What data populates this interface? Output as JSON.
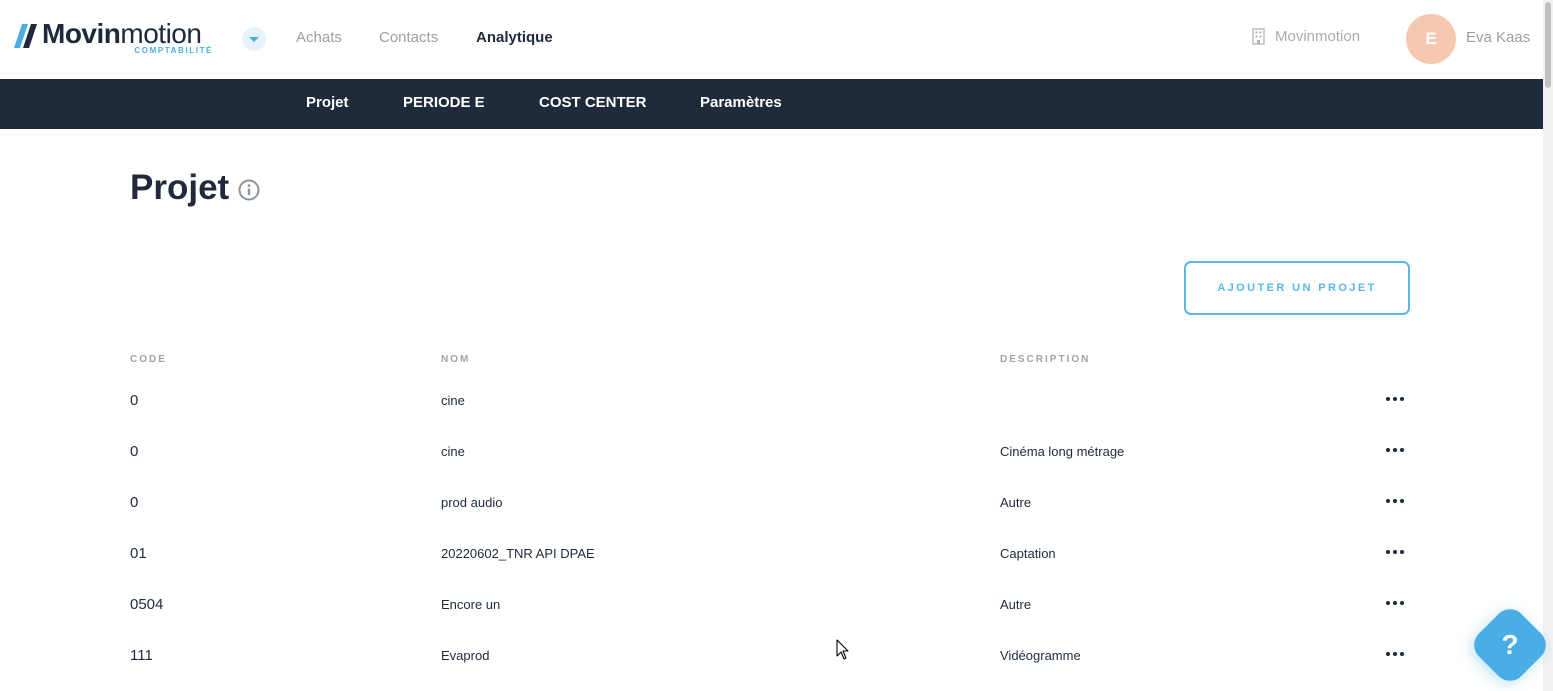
{
  "brand": {
    "name_bold": "Movin",
    "name_light": "motion",
    "subtitle": "COMPTABILITÉ",
    "accent_color": "#4aaee6",
    "dark_color": "#1f2a3b"
  },
  "app_switcher_icon": "chevron-down-icon",
  "top_nav": [
    {
      "label": "Achats",
      "active": false
    },
    {
      "label": "Contacts",
      "active": false
    },
    {
      "label": "Analytique",
      "active": true
    }
  ],
  "company": {
    "icon": "building-icon",
    "label": "Movinmotion"
  },
  "user": {
    "initial": "E",
    "name": "Eva Kaas"
  },
  "sub_nav": [
    {
      "label": "Projet"
    },
    {
      "label": "PERIODE E"
    },
    {
      "label": "COST CENTER"
    },
    {
      "label": "Paramètres"
    }
  ],
  "page": {
    "title": "Projet",
    "info_icon": "info-icon",
    "add_button_label": "AJOUTER UN PROJET"
  },
  "table": {
    "headers": {
      "code": "CODE",
      "nom": "NOM",
      "description": "DESCRIPTION"
    },
    "rows": [
      {
        "code": "0",
        "nom": "cine",
        "description": ""
      },
      {
        "code": "0",
        "nom": "cine",
        "description": "Cinéma long métrage"
      },
      {
        "code": "0",
        "nom": "prod audio",
        "description": "Autre"
      },
      {
        "code": "01",
        "nom": "20220602_TNR API DPAE",
        "description": "Captation"
      },
      {
        "code": "0504",
        "nom": "Encore un",
        "description": "Autre"
      },
      {
        "code": "111",
        "nom": "Evaprod",
        "description": "Vidéogramme"
      }
    ],
    "row_action_icon": "more-horizontal-icon"
  },
  "help": {
    "label": "?"
  }
}
